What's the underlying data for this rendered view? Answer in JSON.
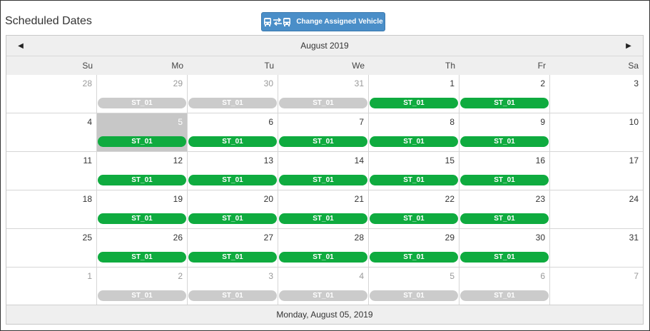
{
  "page": {
    "title": "Scheduled Dates"
  },
  "toolbar": {
    "change_vehicle_label": "Change Assigned Vehicle"
  },
  "colors": {
    "button": "#4a8ec8",
    "event_active": "#0fab3f",
    "event_inactive": "#cbcbcb",
    "selected_day": "#c7c7c7"
  },
  "calendar": {
    "month_label": "August 2019",
    "weekdays": [
      "Su",
      "Mo",
      "Tu",
      "We",
      "Th",
      "Fr",
      "Sa"
    ],
    "footer_label": "Monday, August 05, 2019",
    "weeks": [
      [
        {
          "day": "28",
          "other": true
        },
        {
          "day": "29",
          "other": true,
          "event": "ST_01",
          "event_status": "inactive"
        },
        {
          "day": "30",
          "other": true,
          "event": "ST_01",
          "event_status": "inactive"
        },
        {
          "day": "31",
          "other": true,
          "event": "ST_01",
          "event_status": "inactive"
        },
        {
          "day": "1",
          "event": "ST_01",
          "event_status": "active"
        },
        {
          "day": "2",
          "event": "ST_01",
          "event_status": "active"
        },
        {
          "day": "3"
        }
      ],
      [
        {
          "day": "4"
        },
        {
          "day": "5",
          "selected": true,
          "event": "ST_01",
          "event_status": "active"
        },
        {
          "day": "6",
          "event": "ST_01",
          "event_status": "active"
        },
        {
          "day": "7",
          "event": "ST_01",
          "event_status": "active"
        },
        {
          "day": "8",
          "event": "ST_01",
          "event_status": "active"
        },
        {
          "day": "9",
          "event": "ST_01",
          "event_status": "active"
        },
        {
          "day": "10"
        }
      ],
      [
        {
          "day": "11"
        },
        {
          "day": "12",
          "event": "ST_01",
          "event_status": "active"
        },
        {
          "day": "13",
          "event": "ST_01",
          "event_status": "active"
        },
        {
          "day": "14",
          "event": "ST_01",
          "event_status": "active"
        },
        {
          "day": "15",
          "event": "ST_01",
          "event_status": "active"
        },
        {
          "day": "16",
          "event": "ST_01",
          "event_status": "active"
        },
        {
          "day": "17"
        }
      ],
      [
        {
          "day": "18"
        },
        {
          "day": "19",
          "event": "ST_01",
          "event_status": "active"
        },
        {
          "day": "20",
          "event": "ST_01",
          "event_status": "active"
        },
        {
          "day": "21",
          "event": "ST_01",
          "event_status": "active"
        },
        {
          "day": "22",
          "event": "ST_01",
          "event_status": "active"
        },
        {
          "day": "23",
          "event": "ST_01",
          "event_status": "active"
        },
        {
          "day": "24"
        }
      ],
      [
        {
          "day": "25"
        },
        {
          "day": "26",
          "event": "ST_01",
          "event_status": "active"
        },
        {
          "day": "27",
          "event": "ST_01",
          "event_status": "active"
        },
        {
          "day": "28",
          "event": "ST_01",
          "event_status": "active"
        },
        {
          "day": "29",
          "event": "ST_01",
          "event_status": "active"
        },
        {
          "day": "30",
          "event": "ST_01",
          "event_status": "active"
        },
        {
          "day": "31"
        }
      ],
      [
        {
          "day": "1",
          "other": true
        },
        {
          "day": "2",
          "other": true,
          "event": "ST_01",
          "event_status": "inactive"
        },
        {
          "day": "3",
          "other": true,
          "event": "ST_01",
          "event_status": "inactive"
        },
        {
          "day": "4",
          "other": true,
          "event": "ST_01",
          "event_status": "inactive"
        },
        {
          "day": "5",
          "other": true,
          "event": "ST_01",
          "event_status": "inactive"
        },
        {
          "day": "6",
          "other": true,
          "event": "ST_01",
          "event_status": "inactive"
        },
        {
          "day": "7",
          "other": true
        }
      ]
    ]
  }
}
